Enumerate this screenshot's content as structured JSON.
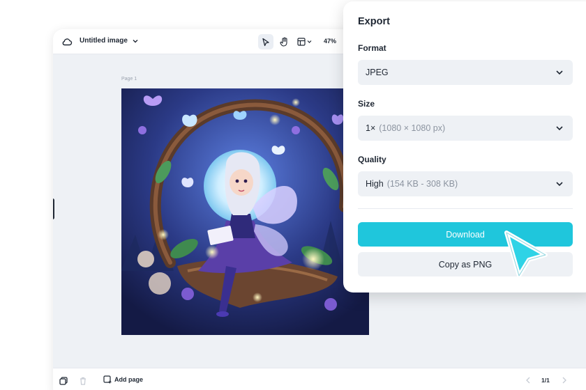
{
  "editor": {
    "title": "Untitled image",
    "zoom": "47%",
    "page_label": "Page 1",
    "add_page_label": "Add page",
    "page_counter": "1/1"
  },
  "export_panel": {
    "title": "Export",
    "format": {
      "label": "Format",
      "value": "JPEG"
    },
    "size": {
      "label": "Size",
      "value": "1×",
      "detail": "(1080 × 1080 px)"
    },
    "quality": {
      "label": "Quality",
      "value": "High",
      "detail": "(154 KB - 308 KB)"
    },
    "download_label": "Download",
    "copy_png_label": "Copy as PNG"
  },
  "icons": {
    "cloud": "cloud-icon",
    "select_tool": "pointer-icon",
    "hand_tool": "hand-icon",
    "layout_tool": "layout-icon",
    "pages": "pages-icon",
    "delete": "trash-icon",
    "add_page": "add-page-icon",
    "cursor": "arrow-cursor-icon"
  },
  "colors": {
    "accent": "#1fc6dc",
    "panel_bg": "#ffffff",
    "field_bg": "#eef1f5",
    "text": "#1f2733",
    "muted": "#8c94a0"
  }
}
